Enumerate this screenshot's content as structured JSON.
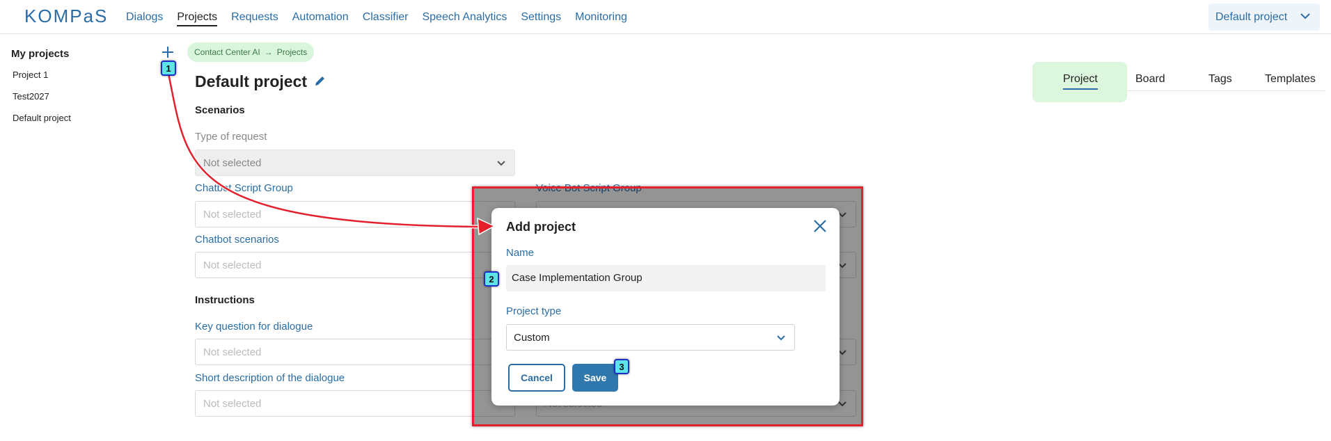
{
  "app": {
    "logo": "KOMPaS"
  },
  "nav": {
    "items": [
      {
        "label": "Dialogs",
        "active": false
      },
      {
        "label": "Projects",
        "active": true
      },
      {
        "label": "Requests",
        "active": false
      },
      {
        "label": "Automation",
        "active": false
      },
      {
        "label": "Classifier",
        "active": false
      },
      {
        "label": "Speech Analytics",
        "active": false
      },
      {
        "label": "Settings",
        "active": false
      },
      {
        "label": "Monitoring",
        "active": false
      }
    ],
    "project_select": "Default project"
  },
  "sidebar": {
    "title": "My projects",
    "items": [
      "Project 1",
      "Test2027",
      "Default project"
    ]
  },
  "breadcrumb": {
    "part1": "Contact Center AI",
    "separator": "→",
    "part2": "Projects"
  },
  "page": {
    "title": "Default project"
  },
  "tabs": [
    "Project",
    "Board",
    "Tags",
    "Templates"
  ],
  "form": {
    "scenarios_title": "Scenarios",
    "type_of_request_label": "Type of request",
    "type_of_request_value": "Not selected",
    "chatbot_group_label": "Chatbot Script Group",
    "chatbot_group_value": "Not selected",
    "voice_bot_label": "Voice Bot Script Group",
    "chatbot_scenarios_label": "Chatbot scenarios",
    "chatbot_scenarios_value": "Not selected",
    "instructions_title": "Instructions",
    "key_question_label": "Key question for dialogue",
    "key_question_value": "Not selected",
    "short_desc_label": "Short description of the dialogue",
    "short_desc_value": "Not selected",
    "right_bottom_value": "Not selected"
  },
  "modal": {
    "title": "Add project",
    "name_label": "Name",
    "name_value": "Case Implementation Group",
    "type_label": "Project type",
    "type_value": "Custom",
    "cancel": "Cancel",
    "save": "Save"
  },
  "markers": [
    "1",
    "2",
    "3"
  ],
  "colors": {
    "accent": "#2a6da6",
    "highlight_green": "#dcf7de",
    "annotation_red": "#e3202b",
    "marker_fill": "#5ee3e8"
  }
}
